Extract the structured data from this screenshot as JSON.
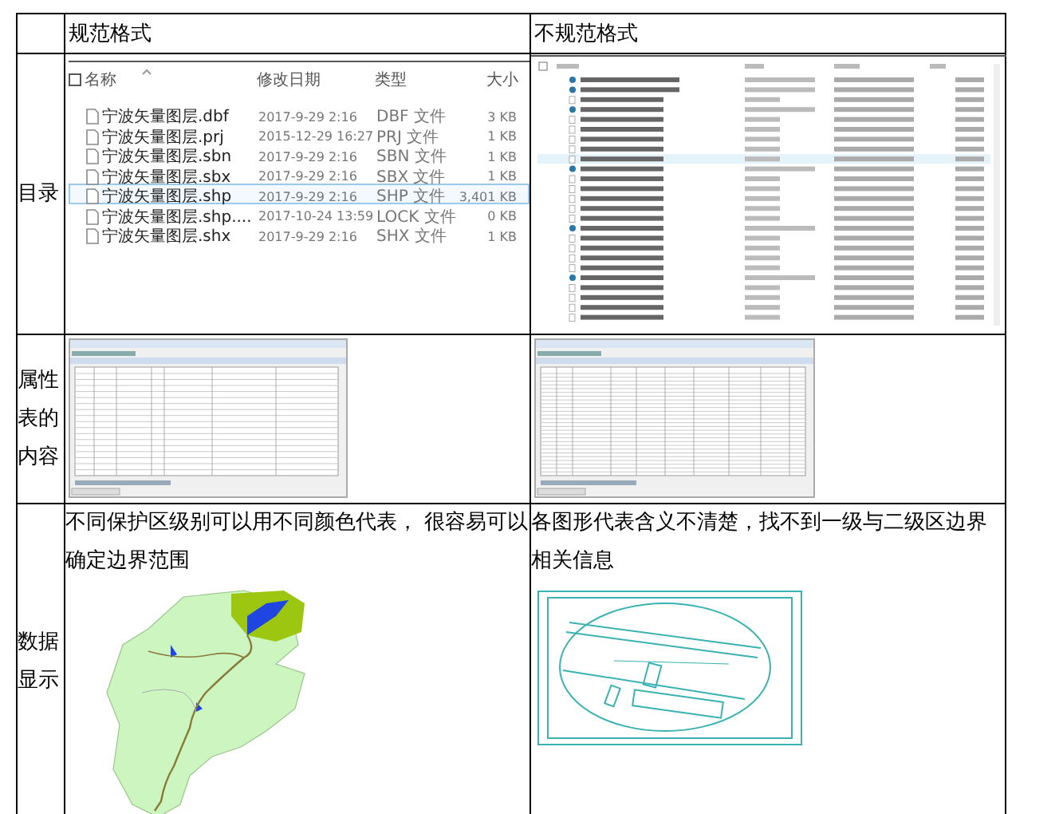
{
  "table": {
    "columns": [
      "规范格式",
      "不规范格式"
    ],
    "rows": [
      {
        "label": "目录",
        "standard": {
          "kind": "file_list",
          "select_all_checked": false,
          "headers": [
            "名称",
            "修改日期",
            "类型",
            "大小"
          ],
          "files": [
            {
              "name": "宁波矢量图层.dbf",
              "date": "2017-9-29 2:16",
              "type": "DBF 文件",
              "size": "3 KB",
              "selected": false
            },
            {
              "name": "宁波矢量图层.prj",
              "date": "2015-12-29 16:27",
              "type": "PRJ 文件",
              "size": "1 KB",
              "selected": false
            },
            {
              "name": "宁波矢量图层.sbn",
              "date": "2017-9-29 2:16",
              "type": "SBN 文件",
              "size": "1 KB",
              "selected": false
            },
            {
              "name": "宁波矢量图层.sbx",
              "date": "2017-9-29 2:16",
              "type": "SBX 文件",
              "size": "1 KB",
              "selected": false
            },
            {
              "name": "宁波矢量图层.shp",
              "date": "2017-9-29 2:16",
              "type": "SHP 文件",
              "size": "3,401 KB",
              "selected": true
            },
            {
              "name": "宁波矢量图层.shp....",
              "date": "2017-10-24 13:59",
              "type": "LOCK 文件",
              "size": "0 KB",
              "selected": false
            },
            {
              "name": "宁波矢量图层.shx",
              "date": "2017-9-29 2:16",
              "type": "SHX 文件",
              "size": "1 KB",
              "selected": false
            }
          ]
        },
        "nonstandard": {
          "kind": "file_list_picture"
        }
      },
      {
        "label": "属性表的内容",
        "standard": {
          "kind": "table_picture"
        },
        "nonstandard": {
          "kind": "wide_table_picture"
        }
      },
      {
        "label": "数据显示",
        "standard": {
          "kind": "map",
          "caption": "不同保护区级别可以用不同颜色代表， 很容易可以确定边界范围"
        },
        "nonstandard": {
          "kind": "cad",
          "caption": "各图形代表含义不清楚，找不到一级与二级区边界相关信息"
        }
      }
    ]
  }
}
